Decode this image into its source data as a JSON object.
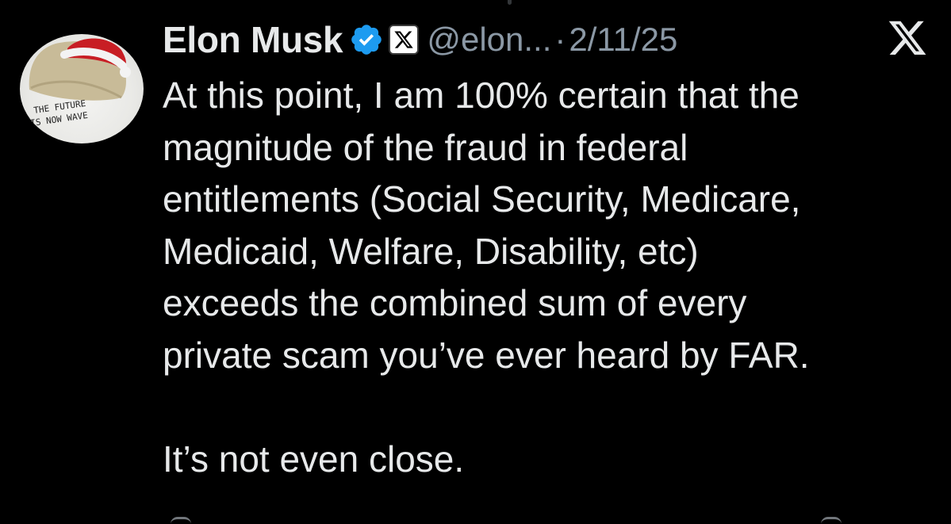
{
  "author": {
    "display_name": "Elon Musk",
    "handle": "@elon...",
    "separator": "·",
    "date": "2/11/25",
    "verified": true,
    "avatar_text": [
      "THE FUTURE",
      "IS NOW WAVE"
    ]
  },
  "tweet": {
    "lines": [
      "At this point, I am 100% certain that the",
      "magnitude of the fraud in federal",
      "entitlements (Social Security, Medicare,",
      "Medicaid, Welfare, Disability, etc)",
      "exceeds the combined sum of every",
      "private scam you’ve ever heard by FAR.",
      "",
      "It’s not even close."
    ]
  },
  "icons": {
    "verified": "verified-badge-icon",
    "affiliate": "x-affiliate-badge-icon",
    "platform": "x-logo-icon"
  },
  "colors": {
    "background": "#000000",
    "text": "#e7e9ea",
    "secondary_text": "#8b98a5",
    "verified_blue": "#1d9bf0"
  }
}
